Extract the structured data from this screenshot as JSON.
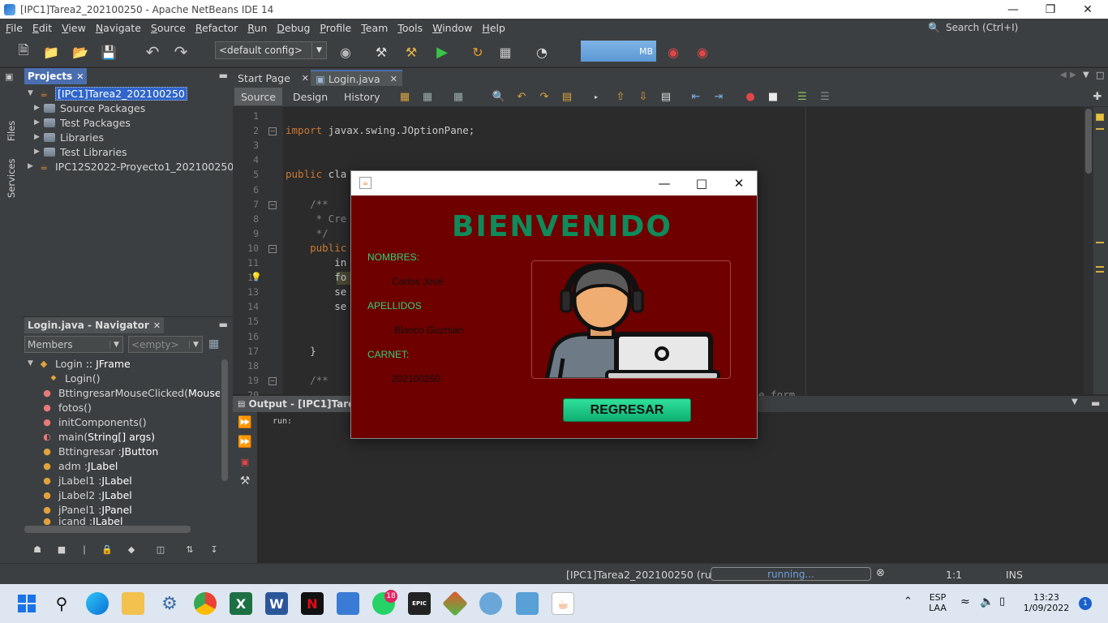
{
  "window": {
    "title": "[IPC1]Tarea2_202100250 - Apache NetBeans IDE 14",
    "minimize": "—",
    "maximize": "❐",
    "close": "✕"
  },
  "menu": [
    "File",
    "Edit",
    "View",
    "Navigate",
    "Source",
    "Refactor",
    "Run",
    "Debug",
    "Profile",
    "Team",
    "Tools",
    "Window",
    "Help"
  ],
  "search": {
    "placeholder": "Search (Ctrl+I)"
  },
  "toolbar": {
    "config": "<default config>",
    "memory": "MB"
  },
  "side_tabs": {
    "files": "Files",
    "services": "Services"
  },
  "projects": {
    "tab": "Projects",
    "items": [
      {
        "label": "[IPC1]Tarea2_202100250",
        "level": 0,
        "expanded": true,
        "selected": true
      },
      {
        "label": "Source Packages",
        "level": 1
      },
      {
        "label": "Test Packages",
        "level": 1
      },
      {
        "label": "Libraries",
        "level": 1
      },
      {
        "label": "Test Libraries",
        "level": 1
      },
      {
        "label": "IPC12S2022-Proyecto1_202100250",
        "level": 0
      }
    ]
  },
  "navigator": {
    "tab": "Login.java - Navigator",
    "filter": "Members",
    "empty": "<empty>",
    "root": {
      "name": "Login",
      "type": ":: JFrame"
    },
    "items": [
      {
        "name": "Login()",
        "type": ""
      },
      {
        "name": "BttingresarMouseClicked(",
        "type": "MouseEv"
      },
      {
        "name": "fotos()",
        "type": ""
      },
      {
        "name": "initComponents()",
        "type": ""
      },
      {
        "name": "main(",
        "type": "String[] args)"
      },
      {
        "name": "Bttingresar : ",
        "type": "JButton"
      },
      {
        "name": "adm : ",
        "type": "JLabel"
      },
      {
        "name": "jLabel1 : ",
        "type": "JLabel"
      },
      {
        "name": "jLabel2 : ",
        "type": "JLabel"
      },
      {
        "name": "jPanel1 : ",
        "type": "JPanel"
      },
      {
        "name": "icand : ",
        "type": "JLabel"
      }
    ]
  },
  "editor": {
    "tabs": [
      {
        "label": "Start Page",
        "active": false
      },
      {
        "label": "Login.java",
        "active": true
      }
    ],
    "subtabs": [
      "Source",
      "Design",
      "History"
    ],
    "lines": [
      {
        "n": "1",
        "text": ""
      },
      {
        "n": "2",
        "text": "import javax.swing.JOptionPane;"
      },
      {
        "n": "3",
        "text": ""
      },
      {
        "n": "4",
        "text": ""
      },
      {
        "n": "5",
        "text": "public cla"
      },
      {
        "n": "6",
        "text": ""
      },
      {
        "n": "7",
        "text": "    /**"
      },
      {
        "n": "8",
        "text": "     * Cre"
      },
      {
        "n": "9",
        "text": "     */"
      },
      {
        "n": "10",
        "text": "    public"
      },
      {
        "n": "11",
        "text": "        in"
      },
      {
        "n": "12",
        "text": "        fo"
      },
      {
        "n": "13",
        "text": "        se"
      },
      {
        "n": "14",
        "text": "        se"
      },
      {
        "n": "15",
        "text": ""
      },
      {
        "n": "16",
        "text": ""
      },
      {
        "n": "17",
        "text": "    }"
      },
      {
        "n": "18",
        "text": ""
      },
      {
        "n": "19",
        "text": "    /**"
      },
      {
        "n": "20",
        "text": ""
      }
    ],
    "line_tail": "e form"
  },
  "output": {
    "tab": "Output - [IPC1]Tarea2",
    "text": "run:"
  },
  "statusbar": {
    "project": "[IPC1]Tarea2_202100250 (run)",
    "progress": "running...",
    "position": "1:1",
    "mode": "INS"
  },
  "dialog": {
    "heading": "BIENVENIDO",
    "labels": {
      "names": "NOMBRES:",
      "surnames": "APELLIDOS",
      "carnet": "CARNET:"
    },
    "values": {
      "names": "Carlos José",
      "surnames": "Blanco Guzmán",
      "carnet": "202100250"
    },
    "button": "REGRESAR"
  },
  "taskbar": {
    "whatsapp_badge": "18",
    "epic": "EPIC",
    "lang": "ESP",
    "lang_sub": "LAA",
    "time": "13:23",
    "date": "1/09/2022",
    "notif": "1"
  },
  "colors": {
    "accent": "#4b6eaf",
    "dialog_bg": "#6e0000",
    "welcome": "#0f8a5a",
    "label_green": "#2fd07a",
    "button_green": "#1dcc85"
  }
}
